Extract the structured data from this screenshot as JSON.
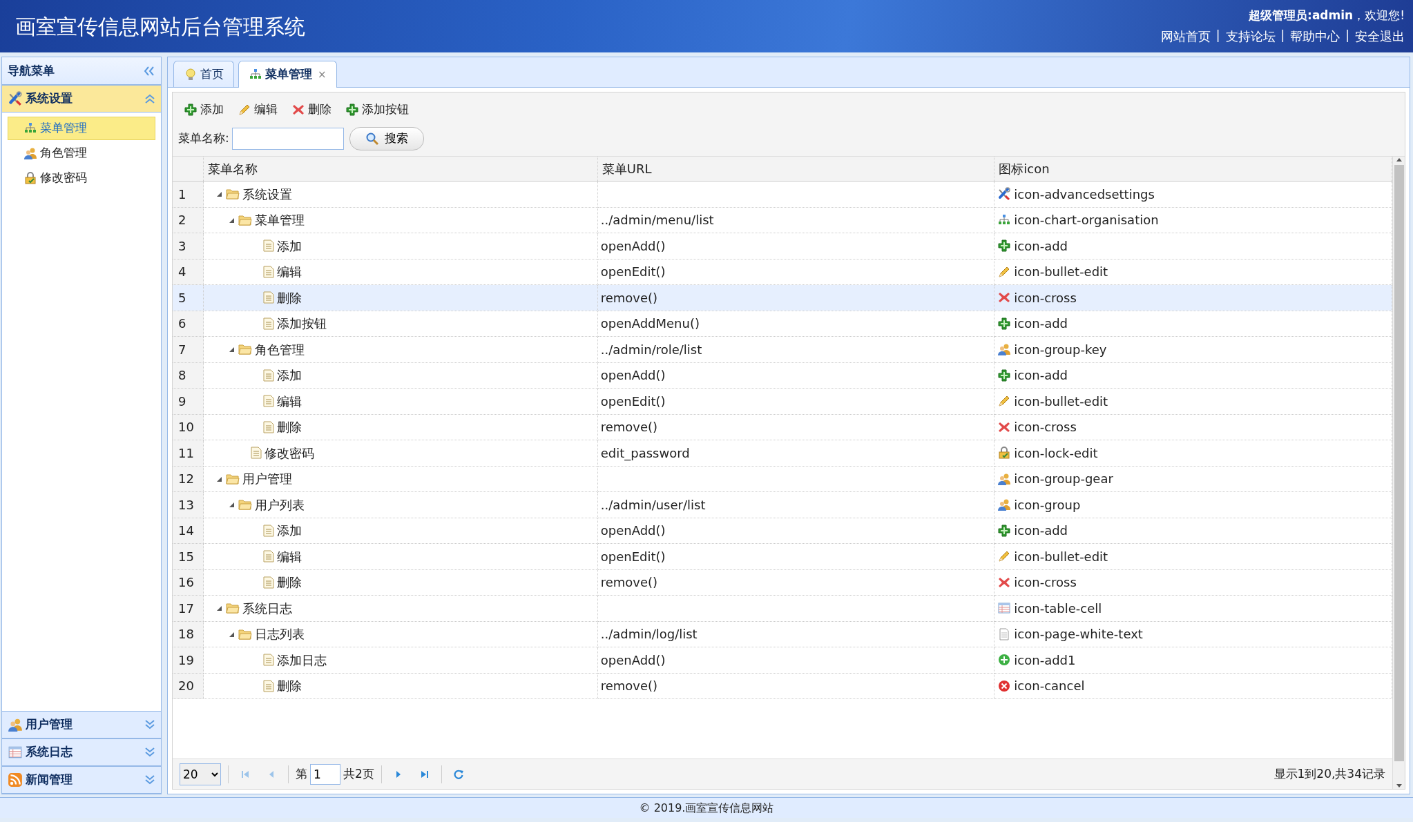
{
  "header": {
    "title": "画室宣传信息网站后台管理系统",
    "user_bold": "超级管理员:admin",
    "user_greeting": "，欢迎您!",
    "links": [
      "网站首页",
      "支持论坛",
      "帮助中心",
      "安全退出"
    ],
    "separator": "|"
  },
  "sidebar": {
    "title": "导航菜单",
    "panels": [
      {
        "title": "系统设置",
        "kind": "tools",
        "expanded": true,
        "items": [
          {
            "label": "菜单管理",
            "kind": "org",
            "selected": true
          },
          {
            "label": "角色管理",
            "kind": "people",
            "selected": false
          },
          {
            "label": "修改密码",
            "kind": "lock",
            "selected": false
          }
        ]
      },
      {
        "title": "用户管理",
        "kind": "people",
        "expanded": false
      },
      {
        "title": "系统日志",
        "kind": "table",
        "expanded": false
      },
      {
        "title": "新闻管理",
        "kind": "rss",
        "expanded": false
      }
    ]
  },
  "tabs": [
    {
      "label": "首页",
      "kind": "bulb",
      "selected": false
    },
    {
      "label": "菜单管理",
      "kind": "org",
      "selected": true,
      "close": "×"
    }
  ],
  "toolbar": [
    {
      "label": "添加",
      "kind": "plus"
    },
    {
      "label": "编辑",
      "kind": "pencil"
    },
    {
      "label": "删除",
      "kind": "cross"
    },
    {
      "label": "添加按钮",
      "kind": "plus"
    }
  ],
  "search": {
    "label": "菜单名称:",
    "button": "搜索"
  },
  "table": {
    "columns": [
      "菜单名称",
      "菜单URL",
      "图标icon"
    ],
    "rows": [
      {
        "num": "1",
        "name": "系统设置",
        "kind": "folder",
        "expanded": true,
        "icon": {
          "kind": "tools",
          "name": "icon-advancedsettings"
        },
        "selected": false,
        "children": [
          {
            "num": "2",
            "name": "菜单管理",
            "kind": "folder",
            "expanded": true,
            "url": "../admin/menu/list",
            "icon": {
              "kind": "org",
              "name": "icon-chart-organisation"
            },
            "selected": false,
            "children": [
              {
                "num": "3",
                "name": "添加",
                "kind": "file",
                "url": "openAdd()",
                "icon": {
                  "kind": "plus",
                  "name": "icon-add"
                },
                "selected": false
              },
              {
                "num": "4",
                "name": "编辑",
                "kind": "file",
                "url": "openEdit()",
                "icon": {
                  "kind": "pencil",
                  "name": "icon-bullet-edit"
                },
                "selected": false
              },
              {
                "num": "5",
                "name": "删除",
                "kind": "file",
                "url": "remove()",
                "icon": {
                  "kind": "cross",
                  "name": "icon-cross"
                },
                "selected": true
              },
              {
                "num": "6",
                "name": "添加按钮",
                "kind": "file",
                "url": "openAddMenu()",
                "icon": {
                  "kind": "plus",
                  "name": "icon-add"
                },
                "selected": false
              }
            ]
          },
          {
            "num": "7",
            "name": "角色管理",
            "kind": "folder",
            "expanded": true,
            "url": "../admin/role/list",
            "icon": {
              "kind": "people",
              "name": "icon-group-key"
            },
            "selected": false,
            "children": [
              {
                "num": "8",
                "name": "添加",
                "kind": "file",
                "url": "openAdd()",
                "icon": {
                  "kind": "plus",
                  "name": "icon-add"
                },
                "selected": false
              },
              {
                "num": "9",
                "name": "编辑",
                "kind": "file",
                "url": "openEdit()",
                "icon": {
                  "kind": "pencil",
                  "name": "icon-bullet-edit"
                },
                "selected": false
              },
              {
                "num": "10",
                "name": "删除",
                "kind": "file",
                "url": "remove()",
                "icon": {
                  "kind": "cross",
                  "name": "icon-cross"
                },
                "selected": false
              }
            ]
          },
          {
            "num": "11",
            "name": "修改密码",
            "kind": "file",
            "url": "edit_password",
            "icon": {
              "kind": "lock",
              "name": "icon-lock-edit"
            },
            "selected": false
          }
        ]
      },
      {
        "num": "12",
        "name": "用户管理",
        "kind": "folder",
        "expanded": true,
        "icon": {
          "kind": "people",
          "name": "icon-group-gear"
        },
        "selected": false,
        "children": [
          {
            "num": "13",
            "name": "用户列表",
            "kind": "folder",
            "expanded": true,
            "url": "../admin/user/list",
            "icon": {
              "kind": "people",
              "name": "icon-group"
            },
            "selected": false,
            "children": [
              {
                "num": "14",
                "name": "添加",
                "kind": "file",
                "url": "openAdd()",
                "icon": {
                  "kind": "plus",
                  "name": "icon-add"
                },
                "selected": false
              },
              {
                "num": "15",
                "name": "编辑",
                "kind": "file",
                "url": "openEdit()",
                "icon": {
                  "kind": "pencil",
                  "name": "icon-bullet-edit"
                },
                "selected": false
              },
              {
                "num": "16",
                "name": "删除",
                "kind": "file",
                "url": "remove()",
                "icon": {
                  "kind": "cross",
                  "name": "icon-cross"
                },
                "selected": false
              }
            ]
          }
        ]
      },
      {
        "num": "17",
        "name": "系统日志",
        "kind": "folder",
        "expanded": true,
        "icon": {
          "kind": "table",
          "name": "icon-table-cell"
        },
        "selected": false,
        "children": [
          {
            "num": "18",
            "name": "日志列表",
            "kind": "folder",
            "expanded": true,
            "url": "../admin/log/list",
            "icon": {
              "kind": "page",
              "name": "icon-page-white-text"
            },
            "selected": false,
            "children": [
              {
                "num": "19",
                "name": "添加日志",
                "kind": "file",
                "url": "openAdd()",
                "icon": {
                  "kind": "circleplus",
                  "name": "icon-add1"
                },
                "selected": false
              },
              {
                "num": "20",
                "name": "删除",
                "kind": "file",
                "url": "remove()",
                "icon": {
                  "kind": "circlex",
                  "name": "icon-cancel"
                },
                "selected": false
              }
            ]
          }
        ]
      }
    ]
  },
  "pagination": {
    "page_size": "20",
    "page_prefix": "第",
    "page": "1",
    "page_total": "共2页",
    "summary": "显示1到20,共34记录"
  },
  "footer": "© 2019.画室宣传信息网站"
}
